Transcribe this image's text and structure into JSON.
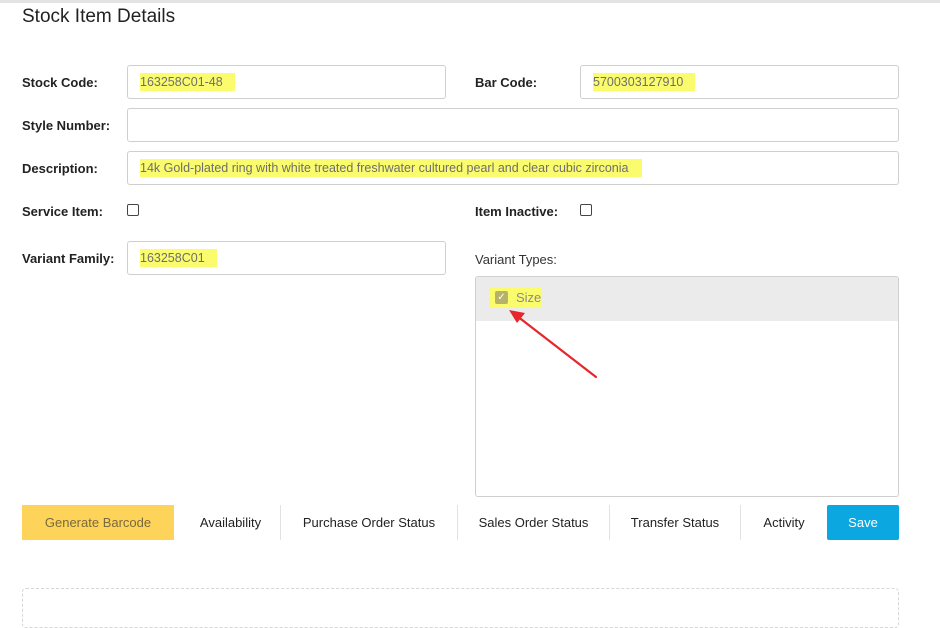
{
  "page": {
    "title": "Stock Item Details"
  },
  "fields": {
    "stock_code": {
      "label": "Stock Code:",
      "value": "163258C01-48"
    },
    "bar_code": {
      "label": "Bar Code:",
      "value": "5700303127910"
    },
    "style_number": {
      "label": "Style Number:",
      "value": ""
    },
    "description": {
      "label": "Description:",
      "value": "14k Gold-plated ring with white treated freshwater cultured pearl and clear cubic zirconia"
    },
    "service_item": {
      "label": "Service Item:",
      "checked": false
    },
    "item_inactive": {
      "label": "Item Inactive:",
      "checked": false
    },
    "variant_family": {
      "label": "Variant Family:",
      "value": "163258C01"
    }
  },
  "variant_types": {
    "label": "Variant Types:",
    "items": [
      {
        "label": "Size",
        "checked": true
      }
    ]
  },
  "toolbar": {
    "generate_barcode": "Generate Barcode",
    "tabs": [
      "Availability",
      "Purchase Order Status",
      "Sales Order Status",
      "Transfer Status",
      "Activity"
    ],
    "save": "Save"
  },
  "colors": {
    "highlight": "#fbfb6e",
    "generate_button": "#fdd35a",
    "save_button": "#0aa7e0",
    "annotation_arrow": "#e8252b"
  },
  "icons": {
    "checkbox_checked": "check-icon",
    "annotation": "arrow-icon"
  }
}
